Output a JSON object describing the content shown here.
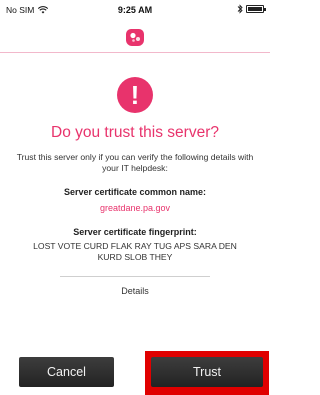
{
  "status_bar": {
    "carrier": "No SIM",
    "time": "9:25 AM",
    "battery_level": 0.85
  },
  "icons": {
    "wifi": "wifi-icon",
    "bluetooth": "bluetooth-icon",
    "battery": "battery-icon",
    "logo": "app-logo-icon",
    "alert": "exclamation-icon"
  },
  "dialog": {
    "alert_symbol": "!",
    "title": "Do you trust this server?",
    "message": "Trust this server only if you can verify the following details with your IT helpdesk:",
    "common_name_label": "Server certificate common name:",
    "common_name_value": "greatdane.pa.gov",
    "fingerprint_label": "Server certificate fingerprint:",
    "fingerprint_value": "LOST VOTE CURD FLAK RAY TUG APS SARA DEN KURD SLOB THEY",
    "details_link": "Details"
  },
  "buttons": {
    "cancel": "Cancel",
    "trust": "Trust"
  },
  "colors": {
    "accent": "#e8336c",
    "button_bg": "#2f2f2f",
    "highlight": "#e00000"
  }
}
